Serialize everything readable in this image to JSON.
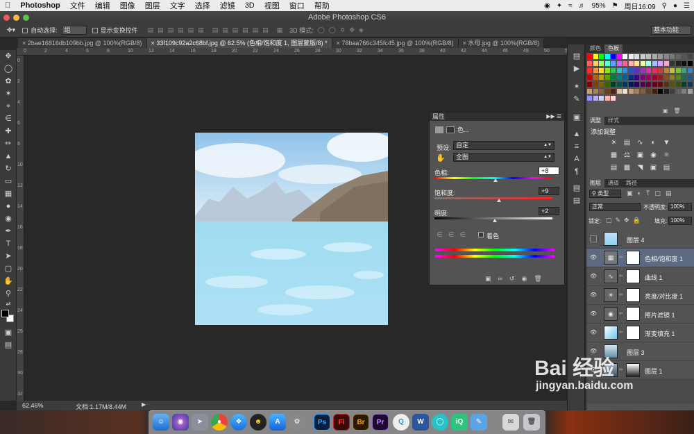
{
  "menubar": {
    "app": "Photoshop",
    "items": [
      "文件",
      "编辑",
      "图像",
      "图层",
      "文字",
      "选择",
      "滤镜",
      "3D",
      "视图",
      "窗口",
      "帮助"
    ],
    "battery": "95%",
    "clock": "周日16:09"
  },
  "window": {
    "title": "Adobe Photoshop CS6"
  },
  "options": {
    "auto_select": "自动选择:",
    "auto_select_value": "组",
    "show_transform": "显示变换控件",
    "mode3d": "3D 模式:",
    "workspace": "基本功能"
  },
  "tabs": [
    "2bae16816db109bb.jpg @ 100%(RGB/8)",
    "33f109c92a2c68bf.jpg @ 62.5% (色相/饱和度 1, 图层蒙版/8) *",
    "78baa766c345fc45.jpg @ 100%(RGB/8)",
    "水母.jpg @ 100%(RGB/8)"
  ],
  "ruler": {
    "h": [
      "0",
      "2",
      "4",
      "6",
      "8",
      "10",
      "12",
      "14",
      "16",
      "18",
      "20",
      "22",
      "24",
      "26",
      "28",
      "30",
      "32",
      "34",
      "36",
      "38",
      "40",
      "42",
      "44",
      "46",
      "48",
      "50",
      "52",
      "54"
    ],
    "v": [
      "0",
      "2",
      "4",
      "6",
      "8",
      "10",
      "12",
      "14",
      "16",
      "18",
      "20",
      "22",
      "24",
      "26",
      "28",
      "30",
      "32"
    ]
  },
  "status": {
    "zoom": "62.46%",
    "doc": "文档:1.17M/8.44M"
  },
  "properties": {
    "panel_title": "属性",
    "heading": "色...",
    "preset_label": "预设:",
    "preset_value": "自定",
    "channel_value": "全图",
    "hue_label": "色相:",
    "hue_value": "+8",
    "sat_label": "饱和度:",
    "sat_value": "+9",
    "light_label": "明度:",
    "light_value": "+2",
    "colorize": "着色",
    "hue_level": 0.52,
    "sat_level": 0.545,
    "light_level": 0.51
  },
  "swatches": {
    "tabs": [
      "颜色",
      "色板"
    ]
  },
  "adjustments": {
    "tabs": [
      "调整",
      "样式"
    ],
    "add": "添加调整"
  },
  "layers": {
    "tabs": [
      "图层",
      "通道",
      "路径"
    ],
    "kind": "类型",
    "blend": "正常",
    "opacity_label": "不透明度:",
    "opacity": "100%",
    "lock": "锁定:",
    "fill_label": "填充:",
    "fill": "100%",
    "items": [
      "图层 4",
      "色相/饱和度 1",
      "曲线 1",
      "亮度/对比度 1",
      "照片滤镜 1",
      "渐变填充 1",
      "图层 3",
      "图层 1"
    ]
  },
  "dock": [
    "Ps",
    "Fl",
    "Br",
    "Pr",
    "W"
  ],
  "watermark": {
    "brand": "Bai 经验",
    "url": "jingyan.baidu.com"
  }
}
